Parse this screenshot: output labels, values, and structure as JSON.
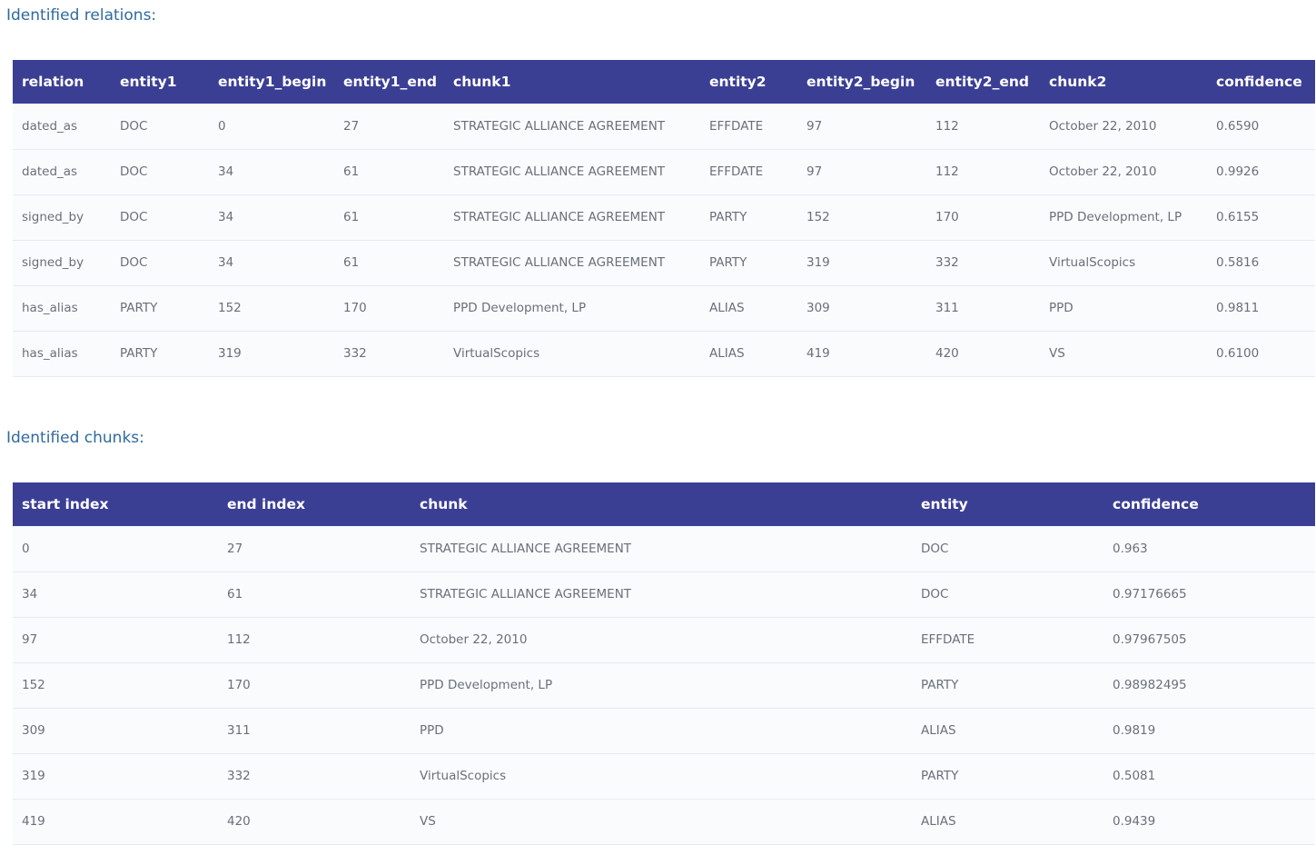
{
  "relations": {
    "title": "Identified relations:",
    "columns": [
      "relation",
      "entity1",
      "entity1_begin",
      "entity1_end",
      "chunk1",
      "entity2",
      "entity2_begin",
      "entity2_end",
      "chunk2",
      "confidence"
    ],
    "rows": [
      [
        "dated_as",
        "DOC",
        "0",
        "27",
        "STRATEGIC ALLIANCE AGREEMENT",
        "EFFDATE",
        "97",
        "112",
        "October 22, 2010",
        "0.6590"
      ],
      [
        "dated_as",
        "DOC",
        "34",
        "61",
        "STRATEGIC ALLIANCE AGREEMENT",
        "EFFDATE",
        "97",
        "112",
        "October 22, 2010",
        "0.9926"
      ],
      [
        "signed_by",
        "DOC",
        "34",
        "61",
        "STRATEGIC ALLIANCE AGREEMENT",
        "PARTY",
        "152",
        "170",
        "PPD Development, LP",
        "0.6155"
      ],
      [
        "signed_by",
        "DOC",
        "34",
        "61",
        "STRATEGIC ALLIANCE AGREEMENT",
        "PARTY",
        "319",
        "332",
        "VirtualScopics",
        "0.5816"
      ],
      [
        "has_alias",
        "PARTY",
        "152",
        "170",
        "PPD Development, LP",
        "ALIAS",
        "309",
        "311",
        "PPD",
        "0.9811"
      ],
      [
        "has_alias",
        "PARTY",
        "319",
        "332",
        "VirtualScopics",
        "ALIAS",
        "419",
        "420",
        "VS",
        "0.6100"
      ]
    ]
  },
  "chunks": {
    "title": "Identified chunks:",
    "columns": [
      "start index",
      "end index",
      "chunk",
      "entity",
      "confidence"
    ],
    "rows": [
      [
        "0",
        "27",
        "STRATEGIC ALLIANCE AGREEMENT",
        "DOC",
        "0.963"
      ],
      [
        "34",
        "61",
        "STRATEGIC ALLIANCE AGREEMENT",
        "DOC",
        "0.97176665"
      ],
      [
        "97",
        "112",
        "October 22, 2010",
        "EFFDATE",
        "0.97967505"
      ],
      [
        "152",
        "170",
        "PPD Development, LP",
        "PARTY",
        "0.98982495"
      ],
      [
        "309",
        "311",
        "PPD",
        "ALIAS",
        "0.9819"
      ],
      [
        "319",
        "332",
        "VirtualScopics",
        "PARTY",
        "0.5081"
      ],
      [
        "419",
        "420",
        "VS",
        "ALIAS",
        "0.9439"
      ]
    ]
  },
  "colors": {
    "header_bg": "#3b3f94",
    "title_text": "#2f6a9e",
    "cell_text": "#6b6f78"
  }
}
